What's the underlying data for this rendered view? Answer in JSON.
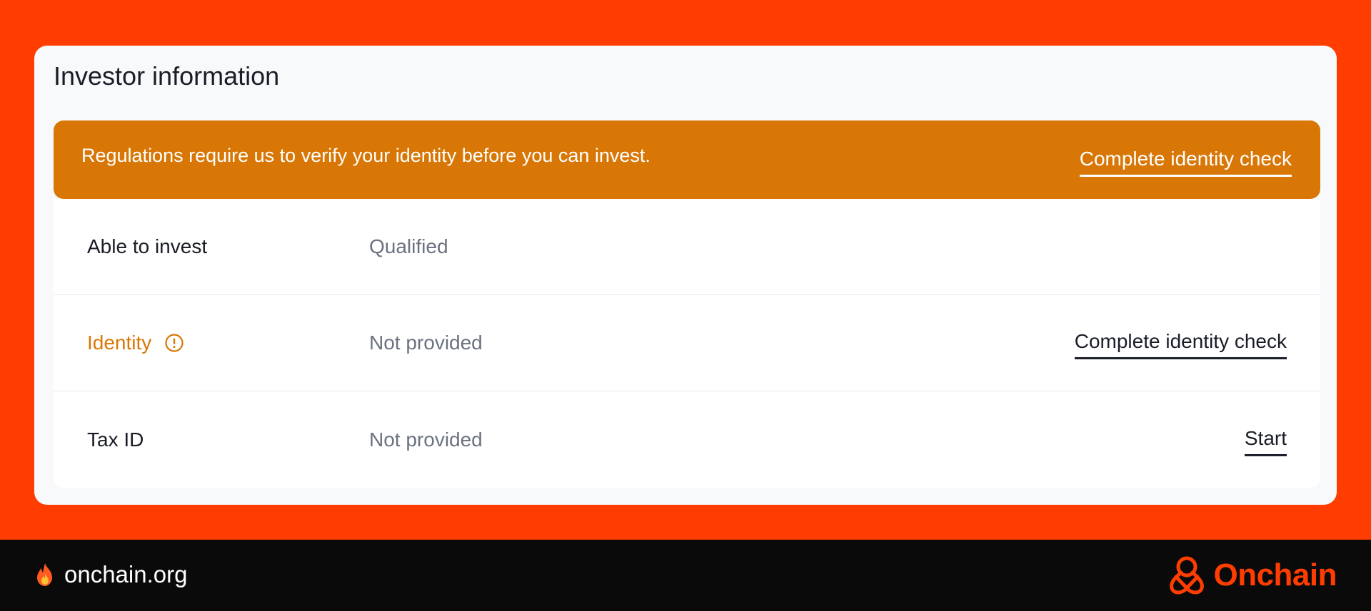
{
  "card": {
    "title": "Investor information"
  },
  "banner": {
    "message": "Regulations require us to verify your identity before you can invest.",
    "action_label": "Complete identity check"
  },
  "rows": [
    {
      "label": "Able to invest",
      "value": "Qualified",
      "action": ""
    },
    {
      "label": "Identity",
      "value": "Not provided",
      "action": "Complete identity check",
      "icon": "warning-icon"
    },
    {
      "label": "Tax ID",
      "value": "Not provided",
      "action": "Start"
    }
  ],
  "footer": {
    "site": "onchain.org",
    "site_icon": "fire-icon",
    "brand": "Onchain"
  },
  "colors": {
    "background": "#ff3d00",
    "banner": "#d97706",
    "warning_text": "#d97706",
    "footer": "#0a0a0a"
  }
}
